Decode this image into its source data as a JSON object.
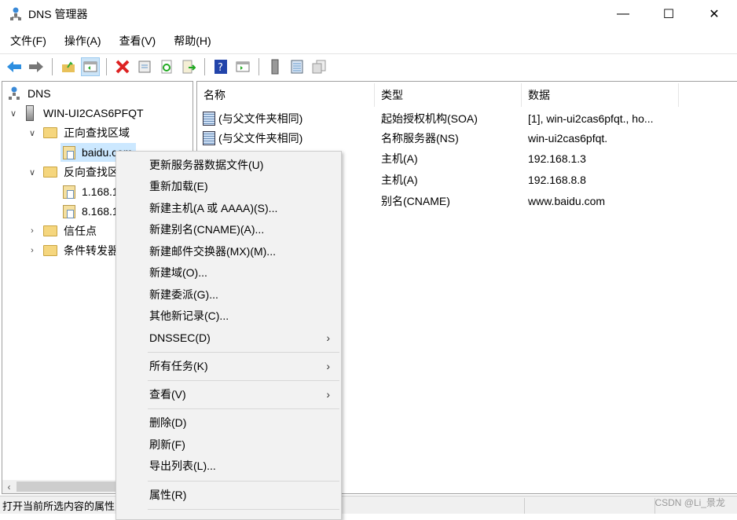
{
  "window": {
    "title": "DNS 管理器",
    "minimize": "—",
    "maximize": "☐",
    "close": "✕"
  },
  "menubar": [
    "文件(F)",
    "操作(A)",
    "查看(V)",
    "帮助(H)"
  ],
  "toolbar": [
    "back-icon",
    "forward-icon",
    "up-folder-icon",
    "show-hide-tree-icon",
    "delete-icon",
    "properties-icon",
    "refresh-icon",
    "export-list-icon",
    "help-icon",
    "show-action-pane-icon",
    "server-icon",
    "records-icon",
    "copy-icon"
  ],
  "tree": {
    "root": "DNS",
    "server": "WIN-UI2CAS6PFQT",
    "forward": "正向查找区域",
    "forward_zone": "baidu.com",
    "reverse": "反向查找区域",
    "reverse_zone1": "1.168.192.in-addr.arpa",
    "reverse_zone2": "8.168.192.in-addr.arpa",
    "trust": "信任点",
    "conditional": "条件转发器"
  },
  "table": {
    "headers": [
      "名称",
      "类型",
      "数据"
    ],
    "rows": [
      {
        "name": "(与父文件夹相同)",
        "type": "起始授权机构(SOA)",
        "data": "[1], win-ui2cas6pfqt., ho..."
      },
      {
        "name": "(与父文件夹相同)",
        "type": "名称服务器(NS)",
        "data": "win-ui2cas6pfqt."
      },
      {
        "name": "",
        "type": "主机(A)",
        "data": "192.168.1.3"
      },
      {
        "name": "",
        "type": "主机(A)",
        "data": "192.168.8.8"
      },
      {
        "name": "",
        "type": "别名(CNAME)",
        "data": "www.baidu.com"
      }
    ]
  },
  "context_menu": [
    "更新服务器数据文件(U)",
    "重新加载(E)",
    "新建主机(A 或 AAAA)(S)...",
    "新建别名(CNAME)(A)...",
    "新建邮件交换器(MX)(M)...",
    "新建域(O)...",
    "新建委派(G)...",
    "其他新记录(C)...",
    "DNSSEC(D)",
    "所有任务(K)",
    "查看(V)",
    "删除(D)",
    "刷新(F)",
    "导出列表(L)...",
    "属性(R)"
  ],
  "submenu_arrow": "›",
  "status": "打开当前所选内容的属性对话框。",
  "watermark": "CSDN @Li_景龙"
}
